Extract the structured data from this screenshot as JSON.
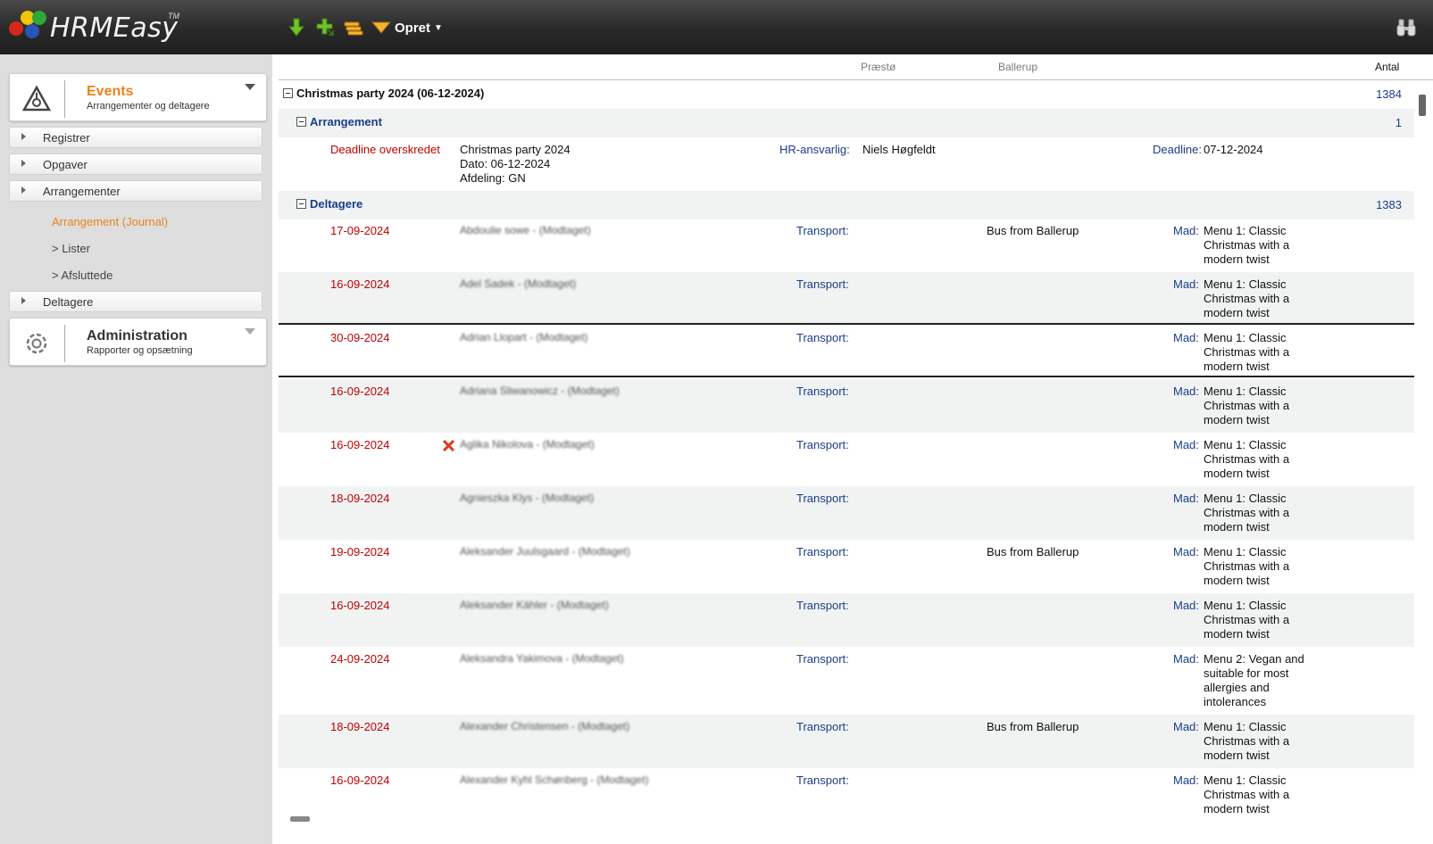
{
  "app": {
    "brand": "HRMEasy",
    "tm": "TM"
  },
  "toolbar": {
    "opret_label": "Opret"
  },
  "sidebar": {
    "events": {
      "title": "Events",
      "subtitle": "Arrangementer og deltagere"
    },
    "nav": [
      {
        "label": "Registrer"
      },
      {
        "label": "Opgaver"
      },
      {
        "label": "Arrangementer"
      }
    ],
    "subnav": [
      {
        "label": "Arrangement (Journal)"
      },
      {
        "label": "> Lister"
      },
      {
        "label": "> Afsluttede"
      }
    ],
    "deltagere_label": "Deltagere",
    "admin": {
      "title": "Administration",
      "subtitle": "Rapporter og opsætning"
    }
  },
  "columns": {
    "praesto": "Præstø",
    "ballerup": "Ballerup",
    "antal": "Antal"
  },
  "event": {
    "title": "Christmas party 2024 (06-12-2024)",
    "count": "1384"
  },
  "arrangement": {
    "title": "Arrangement",
    "count": "1",
    "status": "Deadline overskredet",
    "name": "Christmas party 2024",
    "dato": "Dato: 06-12-2024",
    "afdeling": "Afdeling: GN",
    "hr_label": "HR-ansvarlig:",
    "hr_value": "Niels Høgfeldt",
    "deadline_label": "Deadline:",
    "deadline_value": "07-12-2024"
  },
  "deltagere": {
    "title": "Deltagere",
    "count": "1383",
    "transport_label": "Transport:",
    "mad_label": "Mad:",
    "rows": [
      {
        "date": "17-09-2024",
        "name": "Abdoulie sowe -  (Modtaget)",
        "transport": "Bus from Ballerup",
        "mad": "Menu 1: Classic Christmas with a modern twist"
      },
      {
        "date": "16-09-2024",
        "name": "Adel Sadek -  (Modtaget)",
        "transport": "",
        "mad": "Menu 1: Classic Christmas with a modern twist"
      },
      {
        "date": "30-09-2024",
        "name": "Adrian Llopart -  (Modtaget)",
        "transport": "",
        "mad": "Menu 1: Classic Christmas with a modern twist"
      },
      {
        "date": "16-09-2024",
        "name": "Adriana Sliwanowicz -  (Modtaget)",
        "transport": "",
        "mad": "Menu 1: Classic Christmas with a modern twist"
      },
      {
        "date": "16-09-2024",
        "name": "Aglika Nikolova -  (Modtaget)",
        "transport": "",
        "mad": "Menu 1: Classic Christmas with a modern twist"
      },
      {
        "date": "18-09-2024",
        "name": "Agnieszka Klys -  (Modtaget)",
        "transport": "",
        "mad": "Menu 1: Classic Christmas with a modern twist"
      },
      {
        "date": "19-09-2024",
        "name": "Aleksander Juulsgaard -  (Modtaget)",
        "transport": "Bus from Ballerup",
        "mad": "Menu 1: Classic Christmas with a modern twist"
      },
      {
        "date": "16-09-2024",
        "name": "Aleksander Kähler -  (Modtaget)",
        "transport": "",
        "mad": "Menu 1: Classic Christmas with a modern twist"
      },
      {
        "date": "24-09-2024",
        "name": "Aleksandra Yakimova -  (Modtaget)",
        "transport": "",
        "mad": "Menu 2: Vegan and suitable for most allergies and intolerances"
      },
      {
        "date": "18-09-2024",
        "name": "Alexander Christensen -  (Modtaget)",
        "transport": "Bus from Ballerup",
        "mad": "Menu 1: Classic Christmas with a modern twist"
      },
      {
        "date": "16-09-2024",
        "name": "Alexander Kyhl Schønberg -  (Modtaget)",
        "transport": "",
        "mad": "Menu 1: Classic Christmas with a modern twist"
      }
    ]
  }
}
